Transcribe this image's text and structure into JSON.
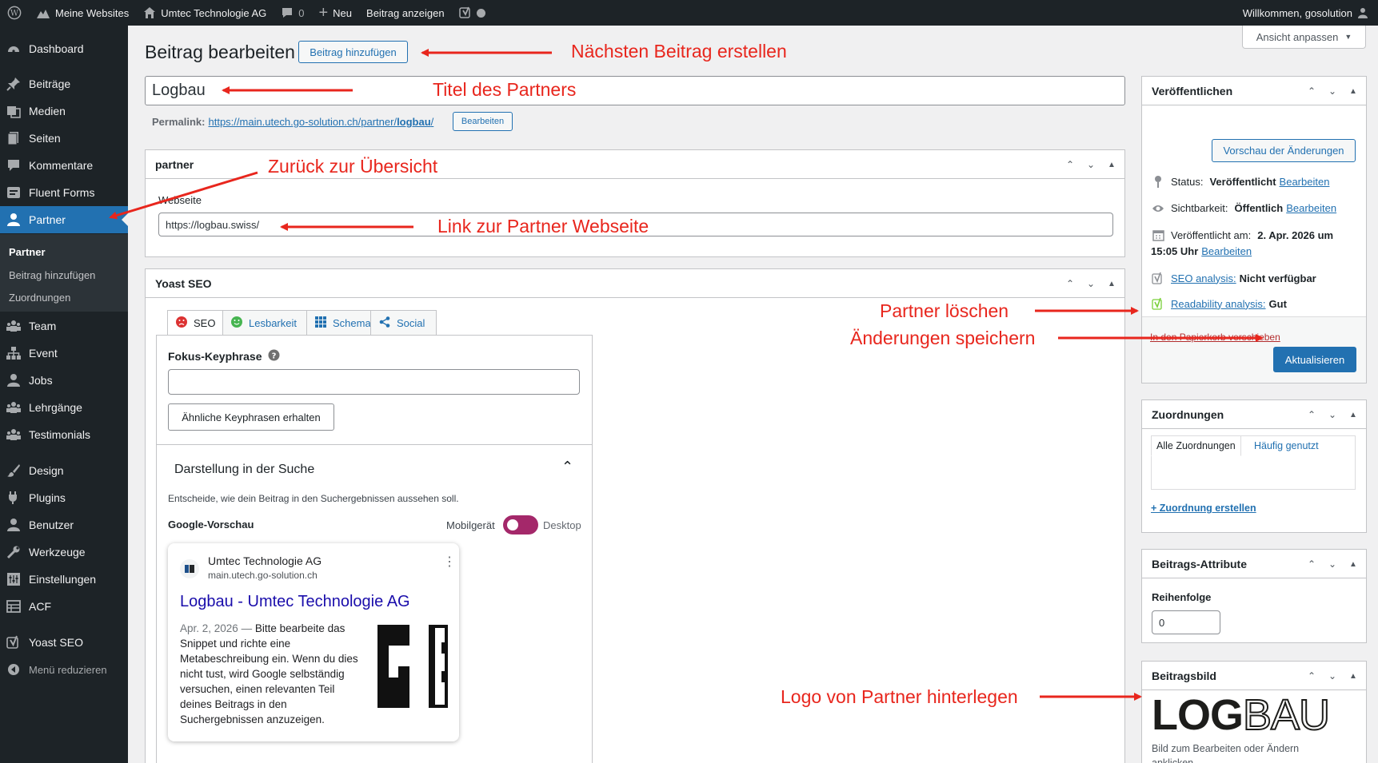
{
  "adminbar": {
    "my_sites": "Meine Websites",
    "site_name": "Umtec Technologie AG",
    "comments_count": "0",
    "new_label": "Neu",
    "view_post": "Beitrag anzeigen",
    "greeting": "Willkommen, gosolution"
  },
  "menu": {
    "dashboard": "Dashboard",
    "beitraege": "Beiträge",
    "medien": "Medien",
    "seiten": "Seiten",
    "kommentare": "Kommentare",
    "fluent_forms": "Fluent Forms",
    "partner": "Partner",
    "sub_partner": "Partner",
    "sub_add": "Beitrag hinzufügen",
    "sub_assign": "Zuordnungen",
    "team": "Team",
    "event": "Event",
    "jobs": "Jobs",
    "lehrgaenge": "Lehrgänge",
    "testimonials": "Testimonials",
    "design": "Design",
    "plugins": "Plugins",
    "benutzer": "Benutzer",
    "werkzeuge": "Werkzeuge",
    "einstellungen": "Einstellungen",
    "acf": "ACF",
    "yoast": "Yoast SEO",
    "collapse": "Menü reduzieren"
  },
  "screen_options": "Ansicht anpassen",
  "page": {
    "title": "Beitrag bearbeiten",
    "add_new": "Beitrag hinzufügen",
    "post_title": "Logbau",
    "permalink_label": "Permalink:",
    "permalink_base": "https://main.utech.go-solution.ch/partner/",
    "permalink_slug": "logbau",
    "permalink_trail": "/",
    "permalink_edit": "Bearbeiten"
  },
  "partner_box": {
    "title": "partner",
    "website_label": "Webseite",
    "website_value": "https://logbau.swiss/"
  },
  "yoast": {
    "title": "Yoast SEO",
    "tabs": [
      "SEO",
      "Lesbarkeit",
      "Schema",
      "Social"
    ],
    "focus_label": "Fokus-Keyphrase",
    "related_button": "Ähnliche Keyphrasen erhalten",
    "search_appearance": "Darstellung in der Suche",
    "search_desc": "Entscheide, wie dein Beitrag in den Suchergebnissen aussehen soll.",
    "google_preview": "Google-Vorschau",
    "mobile": "Mobilgerät",
    "desktop": "Desktop",
    "card_site": "Umtec Technologie AG",
    "card_url": "main.utech.go-solution.ch",
    "card_title": "Logbau - Umtec Technologie AG",
    "card_date": "Apr. 2, 2026",
    "card_dash": "—",
    "card_snippet": "Bitte bearbeite das Snippet und richte eine Metabeschreibung ein. Wenn du dies nicht tust, wird Google selbständig versuchen, einen relevanten Teil deines Beitrags in den Suchergebnissen anzuzeigen."
  },
  "publish": {
    "title": "Veröffentlichen",
    "preview": "Vorschau der Änderungen",
    "status_label": "Status:",
    "status_value": "Veröffentlicht",
    "visibility_label": "Sichtbarkeit:",
    "visibility_value": "Öffentlich",
    "published_label": "Veröffentlicht am:",
    "published_value": "2. Apr. 2026 um",
    "published_time": "15:05 Uhr",
    "edit": "Bearbeiten",
    "seo_label": "SEO analysis:",
    "seo_value": "Nicht verfügbar",
    "readability_label": "Readability analysis:",
    "readability_value": "Gut",
    "trash": "In den Papierkorb verschieben",
    "update": "Aktualisieren"
  },
  "assign_box": {
    "title": "Zuordnungen",
    "tab_all": "Alle Zuordnungen",
    "tab_popular": "Häufig genutzt",
    "create": "+ Zuordnung erstellen"
  },
  "attributes_box": {
    "title": "Beitrags-Attribute",
    "order_label": "Reihenfolge",
    "order_value": "0"
  },
  "image_box": {
    "title": "Beitragsbild",
    "logo_bold": "LOG",
    "logo_light": "BAU",
    "hint": "Bild zum Bearbeiten oder Ändern anklicken"
  },
  "annotations": {
    "next_post": "Nächsten Beitrag erstellen",
    "title_partner": "Titel des Partners",
    "back_overview": "Zurück zur Übersicht",
    "link_website": "Link zur Partner Webseite",
    "delete_partner": "Partner löschen",
    "save_changes": "Änderungen speichern",
    "logo_partner": "Logo von Partner hinterlegen"
  },
  "colors": {
    "wp_blue": "#2271b1",
    "admin_dark": "#1d2327",
    "annotation_red": "#e8261d",
    "yoast_purple": "#a4286a"
  }
}
